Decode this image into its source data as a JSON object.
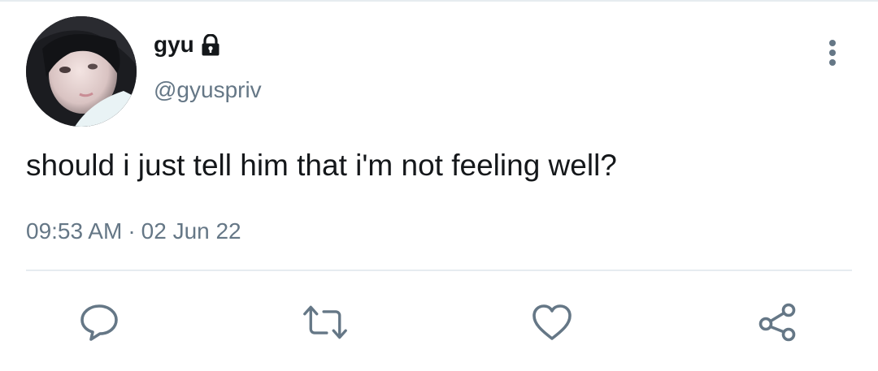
{
  "tweet": {
    "author": {
      "display_name": "gyu",
      "handle": "@gyuspriv",
      "protected_icon": "lock-icon",
      "avatar_icon": "profile-avatar"
    },
    "text": "should i just tell him that i'm not feeling well?",
    "time": "09:53 AM",
    "separator": "·",
    "date": "02 Jun 22"
  },
  "actions": {
    "reply_icon": "reply-icon",
    "retweet_icon": "retweet-icon",
    "like_icon": "heart-icon",
    "share_icon": "share-icon",
    "more_icon": "more-vertical-icon"
  },
  "colors": {
    "text_primary": "#14171a",
    "text_secondary": "#657786",
    "icon": "#657786",
    "divider": "#e6ecf0",
    "background": "#ffffff"
  }
}
